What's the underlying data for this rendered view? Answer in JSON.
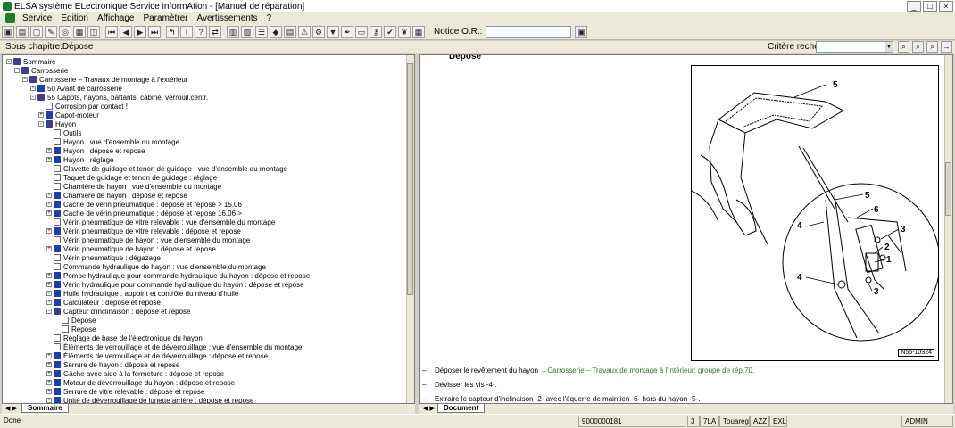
{
  "window": {
    "title": "ELSA système ELectronique Service informAtion - [Manuel de réparation]",
    "controls": [
      "_",
      "□",
      "×"
    ]
  },
  "menu": [
    "Service",
    "Edition",
    "Affichage",
    "Paramètrer",
    "Avertissements",
    "?"
  ],
  "toolbar": {
    "notice_label": "Notice O.R.:",
    "notice_value": ""
  },
  "subheader": {
    "subchapter": "Sous chapitre:Dépose",
    "criteria_label": "Critère recherche:",
    "criteria_value": ""
  },
  "tree": [
    {
      "level": 0,
      "exp": "-",
      "icon": "book-open",
      "label": "Sommaire"
    },
    {
      "level": 1,
      "exp": "-",
      "icon": "book-open",
      "label": "Carrosserie"
    },
    {
      "level": 2,
      "exp": "-",
      "icon": "book-open",
      "label": "Carrosserie – Travaux de montage à l'extérieur"
    },
    {
      "level": 3,
      "exp": "+",
      "icon": "book",
      "label": "50 Avant de carrosserie"
    },
    {
      "level": 3,
      "exp": "-",
      "icon": "book-open",
      "label": "55 Capots, hayons, battants, cabine, verrouil.centr."
    },
    {
      "level": 4,
      "exp": "",
      "icon": "doc",
      "label": "Corrosion par contact !"
    },
    {
      "level": 4,
      "exp": "+",
      "icon": "book",
      "label": "Capot-moteur"
    },
    {
      "level": 4,
      "exp": "-",
      "icon": "book-open",
      "label": "Hayon"
    },
    {
      "level": 5,
      "exp": "",
      "icon": "doc",
      "label": "Outils"
    },
    {
      "level": 5,
      "exp": "",
      "icon": "doc",
      "label": "Hayon : vue d'ensemble du montage"
    },
    {
      "level": 5,
      "exp": "+",
      "icon": "book",
      "label": "Hayon : dépose et repose"
    },
    {
      "level": 5,
      "exp": "+",
      "icon": "book",
      "label": "Hayon : réglage"
    },
    {
      "level": 5,
      "exp": "",
      "icon": "doc",
      "label": "Clavette de guidage et tenon de guidage : vue d'ensemble du montage"
    },
    {
      "level": 5,
      "exp": "",
      "icon": "doc",
      "label": "Taquet de guidage et tenon de guidage : réglage"
    },
    {
      "level": 5,
      "exp": "",
      "icon": "doc",
      "label": "Charnière de hayon : vue d'ensemble du montage"
    },
    {
      "level": 5,
      "exp": "+",
      "icon": "book",
      "label": "Charnière de hayon : dépose et repose"
    },
    {
      "level": 5,
      "exp": "+",
      "icon": "book",
      "label": "Cache de vérin pneumatique : dépose et repose > 15.06"
    },
    {
      "level": 5,
      "exp": "+",
      "icon": "book",
      "label": "Cache de vérin pneumatique : dépose et repose 16.06 >"
    },
    {
      "level": 5,
      "exp": "",
      "icon": "doc",
      "label": "Vérin pneumatique de vitre relevable : vue d'ensemble du montage"
    },
    {
      "level": 5,
      "exp": "+",
      "icon": "book",
      "label": "Vérin pneumatique de vitre relevable : dépose et repose"
    },
    {
      "level": 5,
      "exp": "",
      "icon": "doc",
      "label": "Vérin pneumatique de hayon : vue d'ensemble du montage"
    },
    {
      "level": 5,
      "exp": "+",
      "icon": "book",
      "label": "Vérin pneumatique de hayon : dépose et repose"
    },
    {
      "level": 5,
      "exp": "",
      "icon": "doc",
      "label": "Vérin pneumatique : dégazage"
    },
    {
      "level": 5,
      "exp": "",
      "icon": "doc",
      "label": "Commande hydraulique de hayon : vue d'ensemble du montage"
    },
    {
      "level": 5,
      "exp": "+",
      "icon": "book",
      "label": "Pompe hydraulique pour commande hydraulique du hayon : dépose et repose"
    },
    {
      "level": 5,
      "exp": "+",
      "icon": "book",
      "label": "Vérin hydraulique pour commande hydraulique du hayon : dépose et repose"
    },
    {
      "level": 5,
      "exp": "+",
      "icon": "book",
      "label": "Huile hydraulique : appoint et contrôle du niveau d'huile"
    },
    {
      "level": 5,
      "exp": "+",
      "icon": "book",
      "label": "Calculateur : dépose et repose"
    },
    {
      "level": 5,
      "exp": "-",
      "icon": "book-open",
      "label": "Capteur d'inclinaison : dépose et repose"
    },
    {
      "level": 6,
      "exp": "",
      "icon": "doc",
      "label": "Dépose"
    },
    {
      "level": 6,
      "exp": "",
      "icon": "doc",
      "label": "Repose"
    },
    {
      "level": 5,
      "exp": "",
      "icon": "doc",
      "label": "Réglage de base de l'électronique du hayon"
    },
    {
      "level": 5,
      "exp": "",
      "icon": "doc",
      "label": "Éléments de verrouillage et de déverrouillage : vue d'ensemble du montage"
    },
    {
      "level": 5,
      "exp": "+",
      "icon": "book",
      "label": "Éléments de verrouillage et de déverrouillage : dépose et repose"
    },
    {
      "level": 5,
      "exp": "+",
      "icon": "book",
      "label": "Serrure de hayon : dépose et repose"
    },
    {
      "level": 5,
      "exp": "+",
      "icon": "book",
      "label": "Gâche avec aide à la fermeture : dépose et repose"
    },
    {
      "level": 5,
      "exp": "+",
      "icon": "book",
      "label": "Moteur de déverrouillage du hayon : dépose et repose"
    },
    {
      "level": 5,
      "exp": "+",
      "icon": "book",
      "label": "Serrure de vitre relevable : dépose et repose"
    },
    {
      "level": 5,
      "exp": "+",
      "icon": "book",
      "label": "Unité de déverrouillage de lunette arrière : dépose et repose"
    }
  ],
  "document": {
    "heading": "Dépose",
    "figure_ref": "N55-10324",
    "callouts": [
      "5",
      "5",
      "6",
      "4",
      "3",
      "2",
      "1",
      "4",
      "3"
    ],
    "instructions": [
      {
        "dash": "–",
        "text": "Déposer le revêtement du hayon ",
        "link": "→Carrosserie – Travaux de montage à l'intérieur; groupe de rép.70.",
        "tail": ""
      },
      {
        "dash": "–",
        "text": "Dévisser les vis -4-.",
        "link": "",
        "tail": ""
      },
      {
        "dash": "–",
        "text": "Extraire le capteur d'inclinaison -2- avec l'équerre de maintien -6- hors du hayon -5-.",
        "link": "",
        "tail": ""
      }
    ]
  },
  "tabs": {
    "left": "Sommaire",
    "right": "Document"
  },
  "status": {
    "left": "Done",
    "cells": [
      "9000000181",
      "3",
      "7LA",
      "Touareg",
      "AZZ",
      "EXL",
      "ADMIN"
    ]
  },
  "colors": {
    "link": "#2c7a2c",
    "chrome": "#ece9d8"
  }
}
